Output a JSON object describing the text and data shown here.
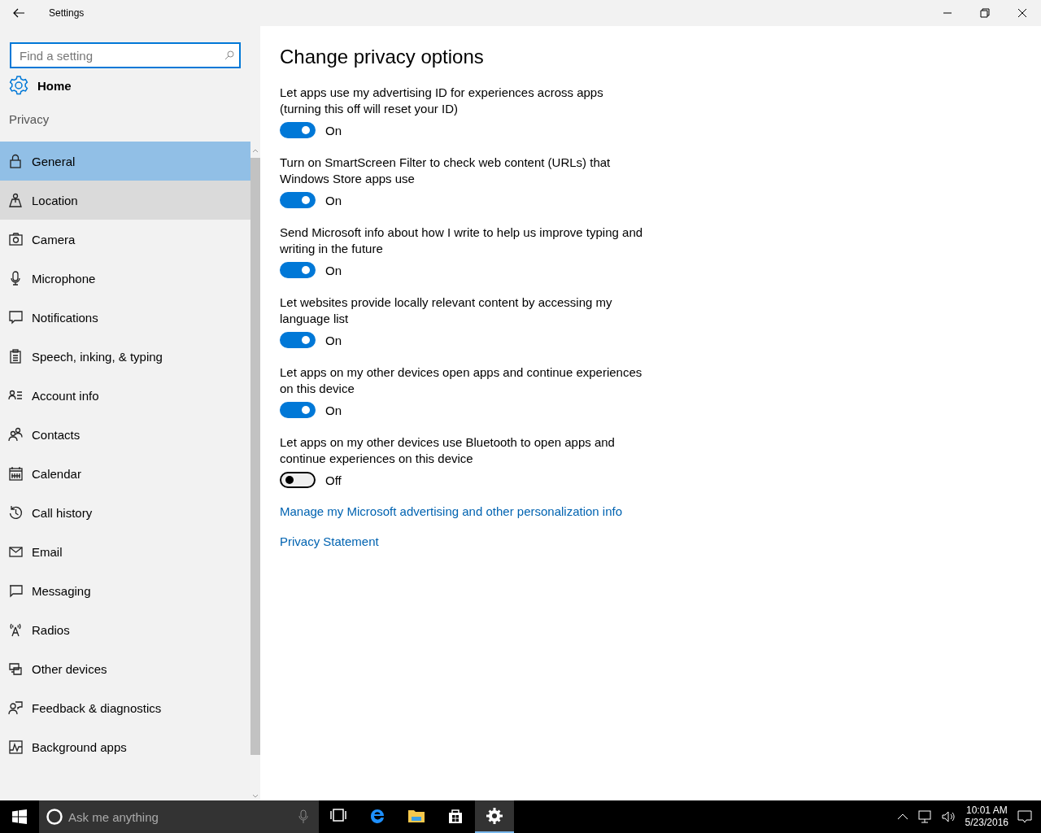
{
  "window": {
    "title": "Settings"
  },
  "sidebar": {
    "search": {
      "placeholder": "Find a setting"
    },
    "home": "Home",
    "section": "Privacy",
    "items": [
      {
        "label": "General",
        "selected": true,
        "hovered": false
      },
      {
        "label": "Location",
        "selected": false,
        "hovered": true
      },
      {
        "label": "Camera",
        "selected": false,
        "hovered": false
      },
      {
        "label": "Microphone",
        "selected": false,
        "hovered": false
      },
      {
        "label": "Notifications",
        "selected": false,
        "hovered": false
      },
      {
        "label": "Speech, inking, & typing",
        "selected": false,
        "hovered": false
      },
      {
        "label": "Account info",
        "selected": false,
        "hovered": false
      },
      {
        "label": "Contacts",
        "selected": false,
        "hovered": false
      },
      {
        "label": "Calendar",
        "selected": false,
        "hovered": false
      },
      {
        "label": "Call history",
        "selected": false,
        "hovered": false
      },
      {
        "label": "Email",
        "selected": false,
        "hovered": false
      },
      {
        "label": "Messaging",
        "selected": false,
        "hovered": false
      },
      {
        "label": "Radios",
        "selected": false,
        "hovered": false
      },
      {
        "label": "Other devices",
        "selected": false,
        "hovered": false
      },
      {
        "label": "Feedback & diagnostics",
        "selected": false,
        "hovered": false
      },
      {
        "label": "Background apps",
        "selected": false,
        "hovered": false
      }
    ]
  },
  "content": {
    "title": "Change privacy options",
    "settings": [
      {
        "description": "Let apps use my advertising ID for experiences across apps (turning this off will reset your ID)",
        "on": true,
        "state_label": "On"
      },
      {
        "description": "Turn on SmartScreen Filter to check web content (URLs) that Windows Store apps use",
        "on": true,
        "state_label": "On"
      },
      {
        "description": "Send Microsoft info about how I write to help us improve typing and writing in the future",
        "on": true,
        "state_label": "On"
      },
      {
        "description": "Let websites provide locally relevant content by accessing my language list",
        "on": true,
        "state_label": "On"
      },
      {
        "description": "Let apps on my other devices open apps and continue experiences on this device",
        "on": true,
        "state_label": "On"
      },
      {
        "description": "Let apps on my other devices use Bluetooth to open apps and continue experiences on this device",
        "on": false,
        "state_label": "Off"
      }
    ],
    "links": [
      "Manage my Microsoft advertising and other personalization info",
      "Privacy Statement"
    ]
  },
  "taskbar": {
    "search_placeholder": "Ask me anything",
    "apps": [
      {
        "selected": false
      },
      {
        "selected": false
      },
      {
        "selected": false
      },
      {
        "selected": false
      },
      {
        "selected": true
      }
    ],
    "time": "10:01 AM",
    "date": "5/23/2016"
  }
}
